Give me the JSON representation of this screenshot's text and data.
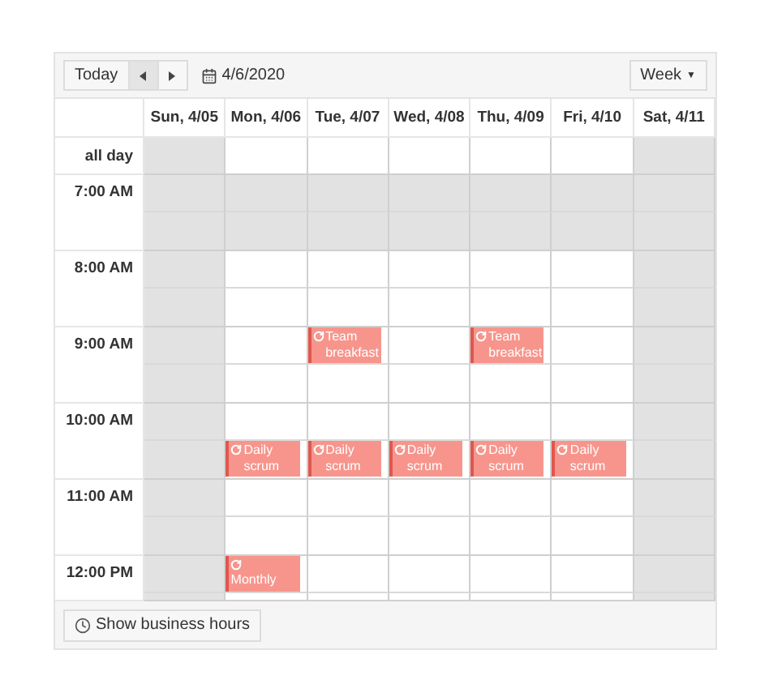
{
  "toolbar": {
    "today": "Today",
    "date": "4/6/2020",
    "view": "Week",
    "view_caret": "▼"
  },
  "days": [
    "Sun, 4/05",
    "Mon, 4/06",
    "Tue, 4/07",
    "Wed, 4/08",
    "Thu, 4/09",
    "Fri, 4/10",
    "Sat, 4/11"
  ],
  "all_day": {
    "label": "all day",
    "cells": [
      {
        "shaded": true
      },
      {
        "shaded": false
      },
      {
        "shaded": false
      },
      {
        "shaded": false
      },
      {
        "shaded": false
      },
      {
        "shaded": false
      },
      {
        "shaded": true
      }
    ]
  },
  "hours": [
    {
      "label": "7:00 AM",
      "halves": [
        [
          {
            "shaded": true
          },
          {
            "shaded": true
          },
          {
            "shaded": true
          },
          {
            "shaded": true
          },
          {
            "shaded": true
          },
          {
            "shaded": true
          },
          {
            "shaded": true
          }
        ],
        [
          {
            "shaded": true
          },
          {
            "shaded": true
          },
          {
            "shaded": true
          },
          {
            "shaded": true
          },
          {
            "shaded": true
          },
          {
            "shaded": true
          },
          {
            "shaded": true
          }
        ]
      ]
    },
    {
      "label": "8:00 AM",
      "halves": [
        [
          {
            "shaded": true
          },
          {
            "shaded": false
          },
          {
            "shaded": false
          },
          {
            "shaded": false
          },
          {
            "shaded": false
          },
          {
            "shaded": false
          },
          {
            "shaded": true
          }
        ],
        [
          {
            "shaded": true
          },
          {
            "shaded": false
          },
          {
            "shaded": false
          },
          {
            "shaded": false
          },
          {
            "shaded": false
          },
          {
            "shaded": false
          },
          {
            "shaded": true
          }
        ]
      ]
    },
    {
      "label": "9:00 AM",
      "halves": [
        [
          {
            "shaded": true
          },
          {
            "shaded": false
          },
          {
            "shaded": false,
            "event": {
              "title": "Team breakfast",
              "kind": "short"
            }
          },
          {
            "shaded": false
          },
          {
            "shaded": false,
            "event": {
              "title": "Team breakfast",
              "kind": "short"
            }
          },
          {
            "shaded": false
          },
          {
            "shaded": true
          }
        ],
        [
          {
            "shaded": true
          },
          {
            "shaded": false
          },
          {
            "shaded": false
          },
          {
            "shaded": false
          },
          {
            "shaded": false
          },
          {
            "shaded": false
          },
          {
            "shaded": true
          }
        ]
      ]
    },
    {
      "label": "10:00 AM",
      "halves": [
        [
          {
            "shaded": true
          },
          {
            "shaded": false
          },
          {
            "shaded": false
          },
          {
            "shaded": false
          },
          {
            "shaded": false
          },
          {
            "shaded": false
          },
          {
            "shaded": true
          }
        ],
        [
          {
            "shaded": true
          },
          {
            "shaded": false,
            "event": {
              "title": "Daily scrum",
              "kind": "short"
            }
          },
          {
            "shaded": false,
            "event": {
              "title": "Daily scrum",
              "kind": "short"
            }
          },
          {
            "shaded": false,
            "event": {
              "title": "Daily scrum",
              "kind": "short"
            }
          },
          {
            "shaded": false,
            "event": {
              "title": "Daily scrum",
              "kind": "short"
            }
          },
          {
            "shaded": false,
            "event": {
              "title": "Daily scrum",
              "kind": "short"
            }
          },
          {
            "shaded": true
          }
        ]
      ]
    },
    {
      "label": "11:00 AM",
      "halves": [
        [
          {
            "shaded": true
          },
          {
            "shaded": false
          },
          {
            "shaded": false
          },
          {
            "shaded": false
          },
          {
            "shaded": false
          },
          {
            "shaded": false
          },
          {
            "shaded": true
          }
        ],
        [
          {
            "shaded": true
          },
          {
            "shaded": false
          },
          {
            "shaded": false
          },
          {
            "shaded": false
          },
          {
            "shaded": false
          },
          {
            "shaded": false
          },
          {
            "shaded": true
          }
        ]
      ]
    },
    {
      "label": "12:00 PM",
      "halves": [
        [
          {
            "shaded": true
          },
          {
            "shaded": false,
            "event": {
              "title": "Monthly",
              "kind": "cut"
            }
          },
          {
            "shaded": false
          },
          {
            "shaded": false
          },
          {
            "shaded": false
          },
          {
            "shaded": false
          },
          {
            "shaded": true
          }
        ],
        [
          {
            "shaded": true
          },
          {
            "shaded": false
          },
          {
            "shaded": false
          },
          {
            "shaded": false
          },
          {
            "shaded": false
          },
          {
            "shaded": false
          },
          {
            "shaded": true
          }
        ]
      ]
    }
  ],
  "footer": {
    "button": "Show business hours"
  }
}
